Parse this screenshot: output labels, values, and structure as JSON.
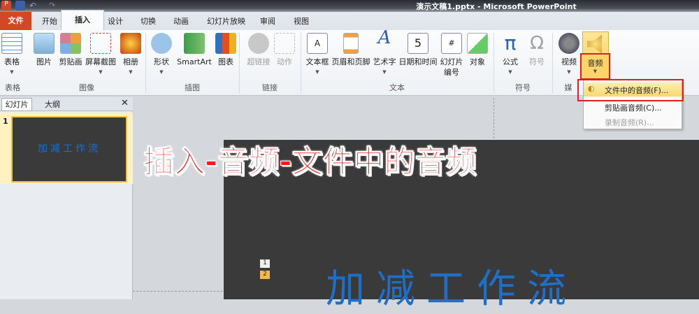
{
  "titlebar": {
    "title": "演示文稿1.pptx - Microsoft PowerPoint",
    "app_icon": "P"
  },
  "tabs": {
    "file": "文件",
    "items": [
      "开始",
      "插入",
      "设计",
      "切换",
      "动画",
      "幻灯片放映",
      "审阅",
      "视图"
    ],
    "active": "插入"
  },
  "ribbon": {
    "groups": [
      "表格",
      "图像",
      "插图",
      "链接",
      "文本",
      "符号",
      "媒"
    ],
    "buttons": {
      "table": "表格",
      "picture": "图片",
      "clipart": "剪贴画",
      "screenshot": "屏幕截图",
      "album": "相册",
      "shapes": "形状",
      "smartart": "SmartArt",
      "chart": "图表",
      "hyperlink": "超链接",
      "action": "动作",
      "textbox": "文本框",
      "header_footer": "页眉和页脚",
      "wordart": "艺术字",
      "datetime": "日期和时间",
      "slide_number": "幻灯片\n编号",
      "object": "对象",
      "equation": "公式",
      "symbol": "符号",
      "video": "视频",
      "audio": "音频"
    }
  },
  "audio_menu": {
    "items": [
      "文件中的音频(F)...",
      "剪贴画音频(C)...",
      "录制音频(R)..."
    ]
  },
  "left_pane": {
    "tabs": [
      "幻灯片",
      "大纲"
    ],
    "close": "✕",
    "slide_number": "1",
    "thumb_text": "加减工作流"
  },
  "overlay": {
    "caption": "插入-音频-文件中的音频"
  },
  "slide": {
    "title": "加减工作流",
    "tags": [
      "1",
      "2"
    ]
  },
  "colors": {
    "file_tab": "#d24726",
    "highlight": "#e02020",
    "caption": "#ff1a1a",
    "accent_blue": "#1e6fc8"
  }
}
